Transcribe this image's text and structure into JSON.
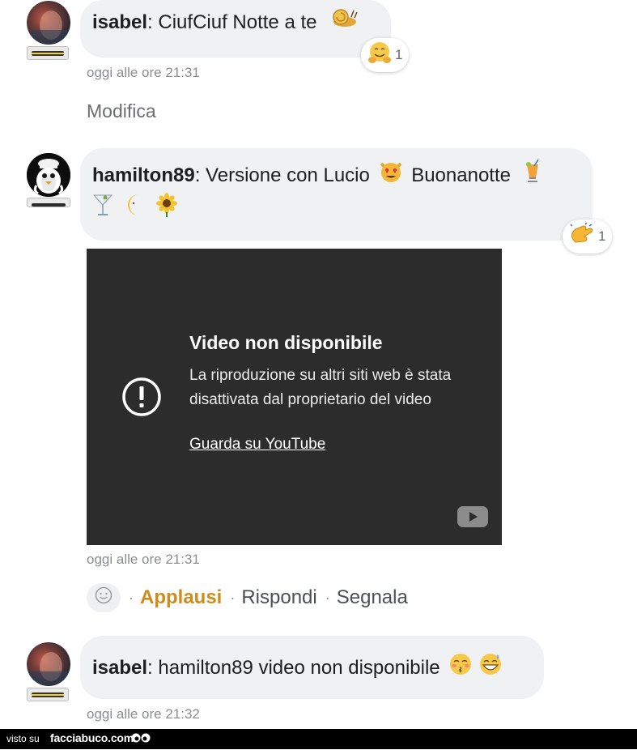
{
  "comments": [
    {
      "author": "isabel",
      "text": "CiufCiuf Notte a te",
      "emoji": [
        "snail"
      ],
      "time": "oggi alle ore 21:31",
      "reaction": {
        "icon": "hugging-face",
        "count": "1"
      },
      "edit_label": "Modifica",
      "rank": "gold"
    },
    {
      "author": "hamilton89",
      "text": "Versione con Lucio",
      "text2": "Buonanotte",
      "emoji": [
        "heart-eyes-cat",
        "tropical-drink",
        "cocktail",
        "crescent-moon",
        "sunflower"
      ],
      "time": "oggi alle ore 21:31",
      "reaction": {
        "icon": "clapping-hands",
        "count": "1"
      },
      "rank": "plain",
      "video": {
        "title": "Video non disponibile",
        "body": "La riproduzione su altri siti web è stata disattivata dal proprietario del video",
        "link": "Guarda su YouTube"
      },
      "actions": {
        "applausi": "Applausi",
        "rispondi": "Rispondi",
        "segnala": "Segnala",
        "separator": "·"
      }
    },
    {
      "author": "isabel",
      "text": "hamilton89 video non disponibile",
      "emoji": [
        "kissing-face",
        "grinning-sweat"
      ],
      "time": "oggi alle ore 21:32",
      "rank": "gold"
    }
  ],
  "footer": {
    "visto": "visto su",
    "brand": "facciabuco.com"
  },
  "colors": {
    "bubble": "#eff1f3",
    "applausi": "#cf8c1c",
    "video_bg": "#2c2c2c",
    "meta": "#8a8d91"
  }
}
